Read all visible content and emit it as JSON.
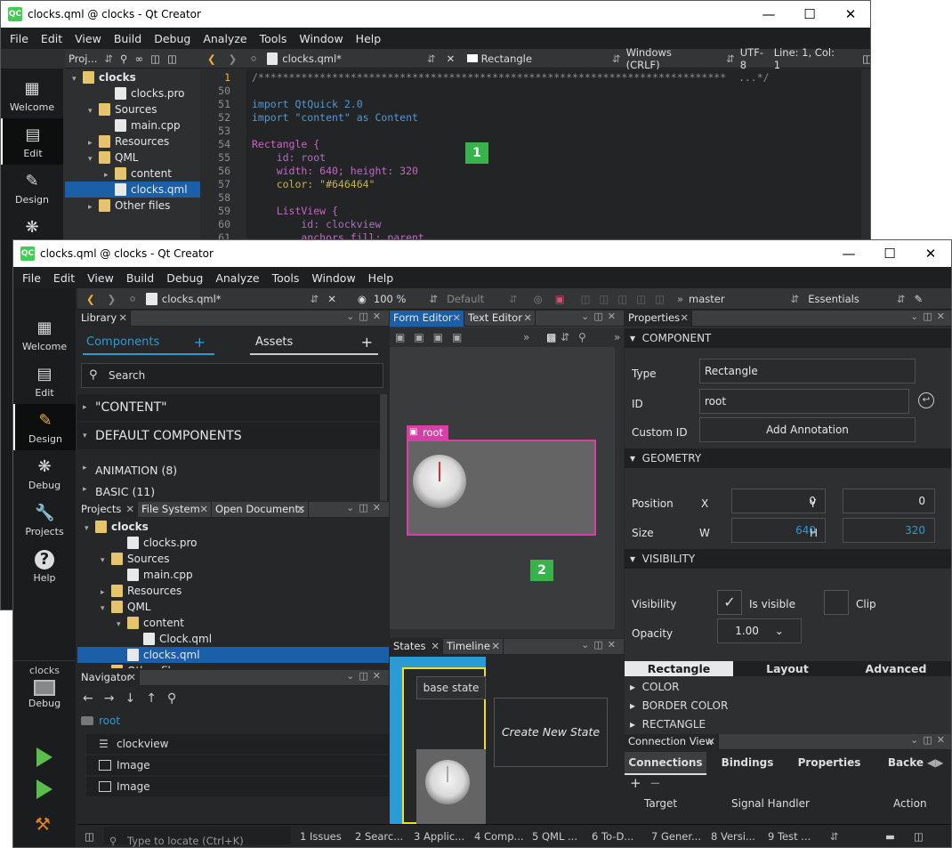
{
  "back_window": {
    "title": "clocks.qml @ clocks - Qt Creator",
    "app_icon": "QC",
    "menu": [
      "File",
      "Edit",
      "View",
      "Build",
      "Debug",
      "Analyze",
      "Tools",
      "Window",
      "Help"
    ],
    "modes": [
      {
        "label": "Welcome",
        "icon": "grid-icon"
      },
      {
        "label": "Edit",
        "icon": "edit-doc-icon"
      },
      {
        "label": "Design",
        "icon": "pencil-icon"
      },
      {
        "label": "",
        "icon": "bug-icon"
      }
    ],
    "projects_combo": "Proj...",
    "tree": [
      {
        "label": "clocks",
        "indent": 0,
        "icon": "project",
        "arrow": "▾",
        "bold": true
      },
      {
        "label": "clocks.pro",
        "indent": 2,
        "icon": "file",
        "arrow": ""
      },
      {
        "label": "Sources",
        "indent": 1,
        "icon": "folder",
        "arrow": "▾"
      },
      {
        "label": "main.cpp",
        "indent": 2,
        "icon": "file",
        "arrow": ""
      },
      {
        "label": "Resources",
        "indent": 1,
        "icon": "folder",
        "arrow": "▸"
      },
      {
        "label": "QML",
        "indent": 1,
        "icon": "folder",
        "arrow": "▾"
      },
      {
        "label": "content",
        "indent": 2,
        "icon": "folder",
        "arrow": "▸"
      },
      {
        "label": "clocks.qml",
        "indent": 2,
        "icon": "file",
        "arrow": "",
        "selected": true
      },
      {
        "label": "Other files",
        "indent": 1,
        "icon": "folder",
        "arrow": "▸"
      }
    ],
    "editor_toolbar": {
      "file": "clocks.qml*",
      "symbol": "Rectangle",
      "line_endings": "Windows (CRLF)",
      "encoding": "UTF-8",
      "position": "Line: 1, Col: 1"
    },
    "code_lines": [
      {
        "n": "1",
        "t": "/****************************************************************************  ...*/"
      },
      {
        "n": "50",
        "t": ""
      },
      {
        "n": "51",
        "t": "import QtQuick 2.0"
      },
      {
        "n": "52",
        "t": "import \"content\" as Content"
      },
      {
        "n": "53",
        "t": ""
      },
      {
        "n": "54",
        "t": "Rectangle {"
      },
      {
        "n": "55",
        "t": "    id: root"
      },
      {
        "n": "56",
        "t": "    width: 640; height: 320"
      },
      {
        "n": "57",
        "t": "    color: \"#646464\""
      },
      {
        "n": "58",
        "t": ""
      },
      {
        "n": "59",
        "t": "    ListView {"
      },
      {
        "n": "60",
        "t": "        id: clockview"
      },
      {
        "n": "61",
        "t": "        anchors.fill: parent"
      }
    ],
    "badge": "1"
  },
  "front_window": {
    "title": "clocks.qml @ clocks - Qt Creator",
    "app_icon": "QC",
    "menu": [
      "File",
      "Edit",
      "View",
      "Build",
      "Debug",
      "Analyze",
      "Tools",
      "Window",
      "Help"
    ],
    "modes": [
      {
        "label": "Welcome",
        "icon": "grid-icon"
      },
      {
        "label": "Edit",
        "icon": "edit-doc-icon"
      },
      {
        "label": "Design",
        "icon": "pencil-icon",
        "active": true
      },
      {
        "label": "Debug",
        "icon": "bug-icon"
      },
      {
        "label": "Projects",
        "icon": "wrench-icon"
      },
      {
        "label": "Help",
        "icon": "help-icon"
      }
    ],
    "kit": {
      "project": "clocks",
      "label": "Debug"
    },
    "toolbar": {
      "file": "clocks.qml*",
      "zoom": "100 %",
      "state": "Default",
      "branch": "master",
      "workspace": "Essentials"
    },
    "library": {
      "tab": "Library",
      "components_tab": "Components",
      "assets_tab": "Assets",
      "search_placeholder": "Search",
      "sections": [
        "\"CONTENT\"",
        "DEFAULT COMPONENTS"
      ],
      "subsections": [
        "ANIMATION (8)",
        "BASIC (11)"
      ]
    },
    "projects_tabs": [
      "Projects",
      "File System",
      "Open Documents"
    ],
    "tree": [
      {
        "label": "clocks",
        "indent": 0,
        "icon": "project",
        "arrow": "▾",
        "bold": true
      },
      {
        "label": "clocks.pro",
        "indent": 2,
        "icon": "file",
        "arrow": ""
      },
      {
        "label": "Sources",
        "indent": 1,
        "icon": "folder",
        "arrow": "▾"
      },
      {
        "label": "main.cpp",
        "indent": 2,
        "icon": "file",
        "arrow": ""
      },
      {
        "label": "Resources",
        "indent": 1,
        "icon": "folder",
        "arrow": "▸"
      },
      {
        "label": "QML",
        "indent": 1,
        "icon": "folder",
        "arrow": "▾"
      },
      {
        "label": "content",
        "indent": 2,
        "icon": "folder",
        "arrow": "▾"
      },
      {
        "label": "Clock.qml",
        "indent": 3,
        "icon": "file",
        "arrow": ""
      },
      {
        "label": "clocks.qml",
        "indent": 2,
        "icon": "file",
        "arrow": "",
        "selected": true
      },
      {
        "label": "Other files",
        "indent": 1,
        "icon": "folder",
        "arrow": "▸"
      }
    ],
    "navigator": {
      "tab": "Navigator",
      "root": "root",
      "items": [
        "clockview",
        "Image",
        "Image"
      ]
    },
    "form_editor": {
      "tabs": [
        "Form Editor",
        "Text Editor"
      ],
      "root_label": "root",
      "badge": "2"
    },
    "states": {
      "tabs": [
        "States",
        "Timeline"
      ],
      "base_state": "base state",
      "create": "Create New State"
    },
    "properties": {
      "tab": "Properties",
      "component_header": "COMPONENT",
      "type_label": "Type",
      "type_value": "Rectangle",
      "id_label": "ID",
      "id_value": "root",
      "custom_id_label": "Custom ID",
      "add_annotation": "Add Annotation",
      "geometry_header": "GEOMETRY",
      "position_label": "Position",
      "x_label": "X",
      "x_value": "0",
      "y_label": "Y",
      "y_value": "0",
      "size_label": "Size",
      "w_label": "W",
      "w_value": "640",
      "h_label": "H",
      "h_value": "320",
      "visibility_header": "VISIBILITY",
      "visibility_label": "Visibility",
      "is_visible": "Is visible",
      "clip": "Clip",
      "opacity_label": "Opacity",
      "opacity_value": "1.00",
      "subtabs": [
        "Rectangle",
        "Layout",
        "Advanced"
      ],
      "groups": [
        "COLOR",
        "BORDER COLOR",
        "RECTANGLE"
      ]
    },
    "connections": {
      "tab": "Connection View",
      "subtabs": [
        "Connections",
        "Bindings",
        "Properties",
        "Backe"
      ],
      "columns": [
        "Target",
        "Signal Handler",
        "Action"
      ]
    },
    "statusbar": {
      "locate_placeholder": "Type to locate (Ctrl+K)",
      "panes": [
        "1  Issues",
        "2  Searc...",
        "3  Applic...",
        "4  Comp...",
        "5  QML ...",
        "6  To-D...",
        "7  Gener...",
        "8  Versi...",
        "9  Test ..."
      ]
    }
  }
}
